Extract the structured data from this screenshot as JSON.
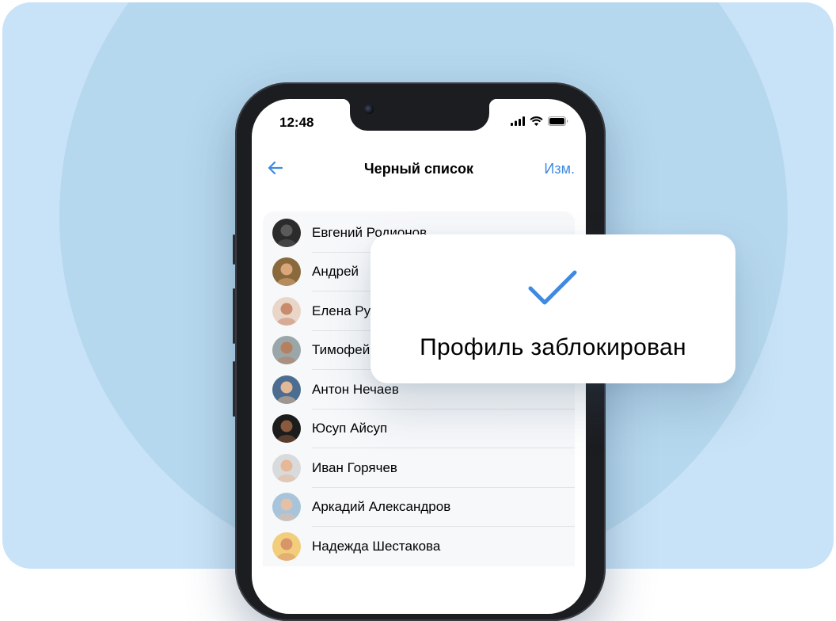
{
  "status_bar": {
    "time": "12:48"
  },
  "nav": {
    "title": "Черный список",
    "edit_label": "Изм."
  },
  "blocked_list": [
    {
      "name": "Евгений Родионов",
      "avatar": {
        "bg": "#2b2b2b",
        "face": "#5a5a5a"
      }
    },
    {
      "name": "Андрей",
      "avatar": {
        "bg": "#8a6a3c",
        "face": "#d9a77a"
      }
    },
    {
      "name": "Елена Ру",
      "avatar": {
        "bg": "#e9d6c9",
        "face": "#c98b6d"
      }
    },
    {
      "name": "Тимофей",
      "avatar": {
        "bg": "#9aa6a8",
        "face": "#b58060"
      }
    },
    {
      "name": "Антон Нечаев",
      "avatar": {
        "bg": "#4c6d8f",
        "face": "#e2b896"
      }
    },
    {
      "name": "Юсуп Айсуп",
      "avatar": {
        "bg": "#1c1c1c",
        "face": "#8a5a3f"
      }
    },
    {
      "name": "Иван Горячев",
      "avatar": {
        "bg": "#d9dadc",
        "face": "#e5b898"
      }
    },
    {
      "name": "Аркадий Александров",
      "avatar": {
        "bg": "#a8c4db",
        "face": "#e6c0a4"
      }
    },
    {
      "name": "Надежда Шестакова",
      "avatar": {
        "bg": "#f2ce7c",
        "face": "#d9956a"
      }
    }
  ],
  "toast": {
    "message": "Профиль заблокирован"
  },
  "colors": {
    "accent": "#3f8ae0",
    "check": "#3f8ae0",
    "background": "#c8e3f7",
    "circle": "#b6d8ee"
  }
}
